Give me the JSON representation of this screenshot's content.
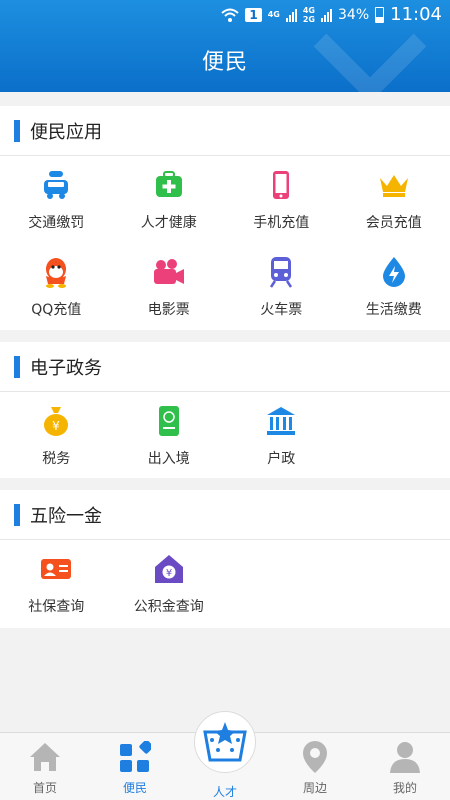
{
  "status": {
    "time": "11:04",
    "battery": "34%",
    "sim": "1",
    "net_top": "4G",
    "net_top2": "4G",
    "net_bottom": "2G"
  },
  "header": {
    "title": "便民"
  },
  "sections": [
    {
      "title": "便民应用",
      "items": [
        {
          "label": "交通缴罚",
          "icon": "car-icon"
        },
        {
          "label": "人才健康",
          "icon": "medical-kit-icon"
        },
        {
          "label": "手机充值",
          "icon": "phone-icon"
        },
        {
          "label": "会员充值",
          "icon": "crown-icon"
        },
        {
          "label": "QQ充值",
          "icon": "qq-icon"
        },
        {
          "label": "电影票",
          "icon": "movie-camera-icon"
        },
        {
          "label": "火车票",
          "icon": "train-icon"
        },
        {
          "label": "生活缴费",
          "icon": "bolt-drop-icon"
        }
      ]
    },
    {
      "title": "电子政务",
      "items": [
        {
          "label": "税务",
          "icon": "money-bag-icon"
        },
        {
          "label": "出入境",
          "icon": "passport-icon"
        },
        {
          "label": "户政",
          "icon": "government-building-icon"
        }
      ]
    },
    {
      "title": "五险一金",
      "items": [
        {
          "label": "社保查询",
          "icon": "id-card-icon"
        },
        {
          "label": "公积金查询",
          "icon": "housing-fund-icon"
        }
      ]
    }
  ],
  "tabs": [
    {
      "label": "首页",
      "icon": "home-icon"
    },
    {
      "label": "便民",
      "icon": "grid-icon"
    },
    {
      "label": "人才",
      "icon": "star-basket-icon"
    },
    {
      "label": "周边",
      "icon": "location-pin-icon"
    },
    {
      "label": "我的",
      "icon": "user-icon"
    }
  ],
  "colors": {
    "header": "#0b6fc9",
    "accent": "#1e7fe0"
  }
}
